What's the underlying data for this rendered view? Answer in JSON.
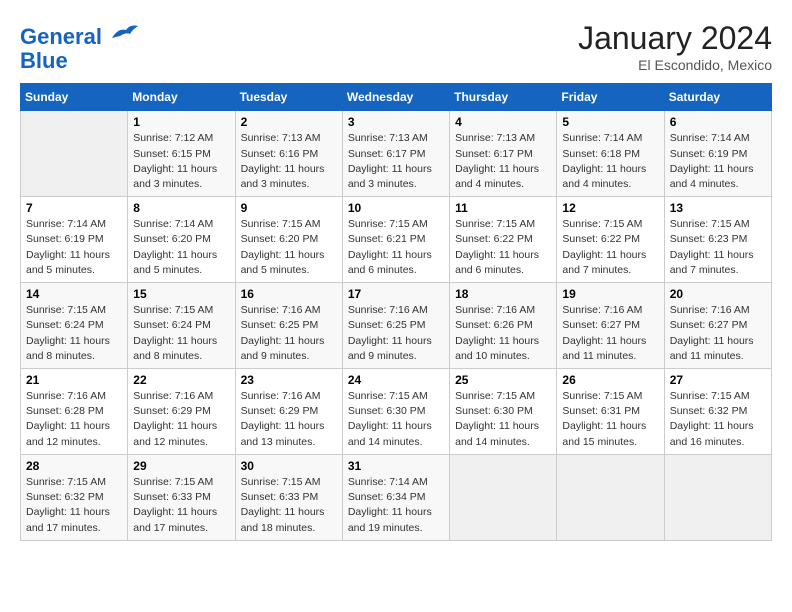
{
  "header": {
    "logo_line1": "General",
    "logo_line2": "Blue",
    "month": "January 2024",
    "location": "El Escondido, Mexico"
  },
  "weekdays": [
    "Sunday",
    "Monday",
    "Tuesday",
    "Wednesday",
    "Thursday",
    "Friday",
    "Saturday"
  ],
  "weeks": [
    [
      {
        "day": "",
        "info": ""
      },
      {
        "day": "1",
        "info": "Sunrise: 7:12 AM\nSunset: 6:15 PM\nDaylight: 11 hours\nand 3 minutes."
      },
      {
        "day": "2",
        "info": "Sunrise: 7:13 AM\nSunset: 6:16 PM\nDaylight: 11 hours\nand 3 minutes."
      },
      {
        "day": "3",
        "info": "Sunrise: 7:13 AM\nSunset: 6:17 PM\nDaylight: 11 hours\nand 3 minutes."
      },
      {
        "day": "4",
        "info": "Sunrise: 7:13 AM\nSunset: 6:17 PM\nDaylight: 11 hours\nand 4 minutes."
      },
      {
        "day": "5",
        "info": "Sunrise: 7:14 AM\nSunset: 6:18 PM\nDaylight: 11 hours\nand 4 minutes."
      },
      {
        "day": "6",
        "info": "Sunrise: 7:14 AM\nSunset: 6:19 PM\nDaylight: 11 hours\nand 4 minutes."
      }
    ],
    [
      {
        "day": "7",
        "info": "Sunrise: 7:14 AM\nSunset: 6:19 PM\nDaylight: 11 hours\nand 5 minutes."
      },
      {
        "day": "8",
        "info": "Sunrise: 7:14 AM\nSunset: 6:20 PM\nDaylight: 11 hours\nand 5 minutes."
      },
      {
        "day": "9",
        "info": "Sunrise: 7:15 AM\nSunset: 6:20 PM\nDaylight: 11 hours\nand 5 minutes."
      },
      {
        "day": "10",
        "info": "Sunrise: 7:15 AM\nSunset: 6:21 PM\nDaylight: 11 hours\nand 6 minutes."
      },
      {
        "day": "11",
        "info": "Sunrise: 7:15 AM\nSunset: 6:22 PM\nDaylight: 11 hours\nand 6 minutes."
      },
      {
        "day": "12",
        "info": "Sunrise: 7:15 AM\nSunset: 6:22 PM\nDaylight: 11 hours\nand 7 minutes."
      },
      {
        "day": "13",
        "info": "Sunrise: 7:15 AM\nSunset: 6:23 PM\nDaylight: 11 hours\nand 7 minutes."
      }
    ],
    [
      {
        "day": "14",
        "info": "Sunrise: 7:15 AM\nSunset: 6:24 PM\nDaylight: 11 hours\nand 8 minutes."
      },
      {
        "day": "15",
        "info": "Sunrise: 7:15 AM\nSunset: 6:24 PM\nDaylight: 11 hours\nand 8 minutes."
      },
      {
        "day": "16",
        "info": "Sunrise: 7:16 AM\nSunset: 6:25 PM\nDaylight: 11 hours\nand 9 minutes."
      },
      {
        "day": "17",
        "info": "Sunrise: 7:16 AM\nSunset: 6:25 PM\nDaylight: 11 hours\nand 9 minutes."
      },
      {
        "day": "18",
        "info": "Sunrise: 7:16 AM\nSunset: 6:26 PM\nDaylight: 11 hours\nand 10 minutes."
      },
      {
        "day": "19",
        "info": "Sunrise: 7:16 AM\nSunset: 6:27 PM\nDaylight: 11 hours\nand 11 minutes."
      },
      {
        "day": "20",
        "info": "Sunrise: 7:16 AM\nSunset: 6:27 PM\nDaylight: 11 hours\nand 11 minutes."
      }
    ],
    [
      {
        "day": "21",
        "info": "Sunrise: 7:16 AM\nSunset: 6:28 PM\nDaylight: 11 hours\nand 12 minutes."
      },
      {
        "day": "22",
        "info": "Sunrise: 7:16 AM\nSunset: 6:29 PM\nDaylight: 11 hours\nand 12 minutes."
      },
      {
        "day": "23",
        "info": "Sunrise: 7:16 AM\nSunset: 6:29 PM\nDaylight: 11 hours\nand 13 minutes."
      },
      {
        "day": "24",
        "info": "Sunrise: 7:15 AM\nSunset: 6:30 PM\nDaylight: 11 hours\nand 14 minutes."
      },
      {
        "day": "25",
        "info": "Sunrise: 7:15 AM\nSunset: 6:30 PM\nDaylight: 11 hours\nand 14 minutes."
      },
      {
        "day": "26",
        "info": "Sunrise: 7:15 AM\nSunset: 6:31 PM\nDaylight: 11 hours\nand 15 minutes."
      },
      {
        "day": "27",
        "info": "Sunrise: 7:15 AM\nSunset: 6:32 PM\nDaylight: 11 hours\nand 16 minutes."
      }
    ],
    [
      {
        "day": "28",
        "info": "Sunrise: 7:15 AM\nSunset: 6:32 PM\nDaylight: 11 hours\nand 17 minutes."
      },
      {
        "day": "29",
        "info": "Sunrise: 7:15 AM\nSunset: 6:33 PM\nDaylight: 11 hours\nand 17 minutes."
      },
      {
        "day": "30",
        "info": "Sunrise: 7:15 AM\nSunset: 6:33 PM\nDaylight: 11 hours\nand 18 minutes."
      },
      {
        "day": "31",
        "info": "Sunrise: 7:14 AM\nSunset: 6:34 PM\nDaylight: 11 hours\nand 19 minutes."
      },
      {
        "day": "",
        "info": ""
      },
      {
        "day": "",
        "info": ""
      },
      {
        "day": "",
        "info": ""
      }
    ]
  ]
}
